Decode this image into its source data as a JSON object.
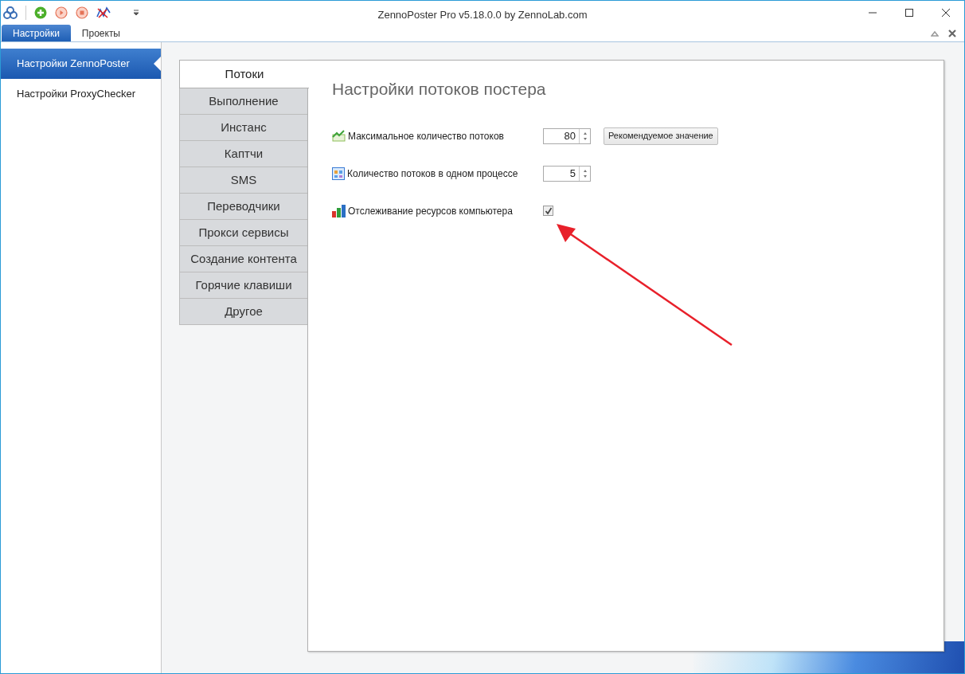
{
  "window": {
    "title": "ZennoPoster Pro v5.18.0.0 by ZennoLab.com"
  },
  "ribbon_tabs": [
    {
      "label": "Настройки",
      "selected": true
    },
    {
      "label": "Проекты",
      "selected": false
    }
  ],
  "sidebar": {
    "items": [
      {
        "label": "Настройки ZennoPoster",
        "selected": true
      },
      {
        "label": "Настройки ProxyChecker",
        "selected": false
      }
    ]
  },
  "settings_tabs": [
    {
      "label": "Потоки",
      "selected": true
    },
    {
      "label": "Выполнение",
      "selected": false
    },
    {
      "label": "Инстанс",
      "selected": false
    },
    {
      "label": "Каптчи",
      "selected": false
    },
    {
      "label": "SMS",
      "selected": false
    },
    {
      "label": "Переводчики",
      "selected": false
    },
    {
      "label": "Прокси сервисы",
      "selected": false
    },
    {
      "label": "Создание контента",
      "selected": false
    },
    {
      "label": "Горячие клавиши",
      "selected": false
    },
    {
      "label": "Другое",
      "selected": false
    }
  ],
  "panel": {
    "title": "Настройки потоков постера",
    "rows": [
      {
        "kind": "spinner",
        "label": "Максимальное количество потоков",
        "value": "80",
        "button": "Рекомендуемое значение"
      },
      {
        "kind": "spinner",
        "label": "Количество потоков в одном процессе",
        "value": "5"
      },
      {
        "kind": "checkbox",
        "label": "Отслеживание ресурсов компьютера",
        "checked": true
      }
    ]
  }
}
